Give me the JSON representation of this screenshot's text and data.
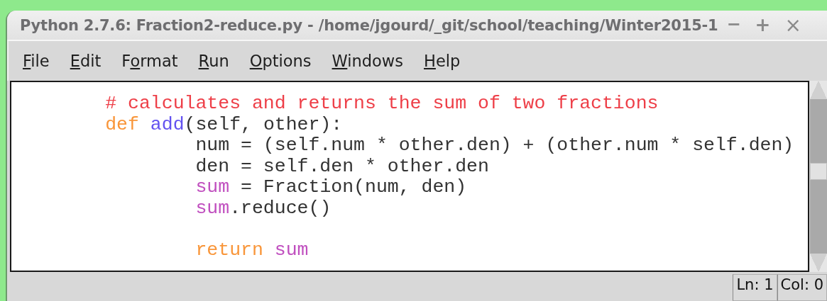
{
  "window": {
    "title": "Python 2.7.6: Fraction2-reduce.py - /home/jgourd/_git/school/teaching/Winter2015-1",
    "controls": [
      {
        "kind": "minimize",
        "label": "−"
      },
      {
        "kind": "maximize",
        "label": "+"
      },
      {
        "kind": "close",
        "label": "×"
      }
    ]
  },
  "menu": [
    {
      "parts": [
        {
          "text": "F",
          "underlined": true
        },
        {
          "text": "ile",
          "underlined": false
        }
      ]
    },
    {
      "parts": [
        {
          "text": "E",
          "underlined": true
        },
        {
          "text": "dit",
          "underlined": false
        }
      ]
    },
    {
      "parts": [
        {
          "text": "F",
          "underlined": false
        },
        {
          "text": "o",
          "underlined": true
        },
        {
          "text": "rmat",
          "underlined": false
        }
      ]
    },
    {
      "parts": [
        {
          "text": "R",
          "underlined": true
        },
        {
          "text": "un",
          "underlined": false
        }
      ]
    },
    {
      "parts": [
        {
          "text": "O",
          "underlined": true
        },
        {
          "text": "ptions",
          "underlined": false
        }
      ]
    },
    {
      "parts": [
        {
          "text": "W",
          "underlined": true
        },
        {
          "text": "indows",
          "underlined": false
        }
      ]
    },
    {
      "parts": [
        {
          "text": "H",
          "underlined": true
        },
        {
          "text": "elp",
          "underlined": false
        }
      ]
    }
  ],
  "editor": {
    "lines": [
      {
        "kind": "code",
        "tokens": [
          {
            "kind": "comment",
            "text": "# calculates and returns the sum of two fractions"
          }
        ]
      },
      {
        "kind": "code",
        "tokens": [
          {
            "kind": "keyword",
            "text": "def"
          },
          {
            "kind": "definition",
            "text": " add"
          },
          {
            "kind": "plain",
            "text": "(self, other):"
          }
        ],
        "children": [
          {
            "kind": "code",
            "tokens": [
              {
                "kind": "plain",
                "text": "num = (self.num * other.den) + (other.num * self.den)"
              }
            ]
          },
          {
            "kind": "code",
            "tokens": [
              {
                "kind": "plain",
                "text": "den = self.den * other.den"
              }
            ]
          },
          {
            "kind": "code",
            "tokens": [
              {
                "kind": "builtin",
                "text": "sum"
              },
              {
                "kind": "plain",
                "text": " = Fraction(num, den)"
              }
            ]
          },
          {
            "kind": "code",
            "tokens": [
              {
                "kind": "builtin",
                "text": "sum"
              },
              {
                "kind": "plain",
                "text": ".reduce()"
              }
            ]
          },
          {
            "kind": "blank"
          },
          {
            "kind": "code",
            "tokens": [
              {
                "kind": "keyword",
                "text": "return"
              },
              {
                "kind": "builtin",
                "text": " sum"
              }
            ]
          }
        ]
      }
    ]
  },
  "status_bar": {
    "line": "Ln: 1",
    "column": "Col: 0"
  }
}
